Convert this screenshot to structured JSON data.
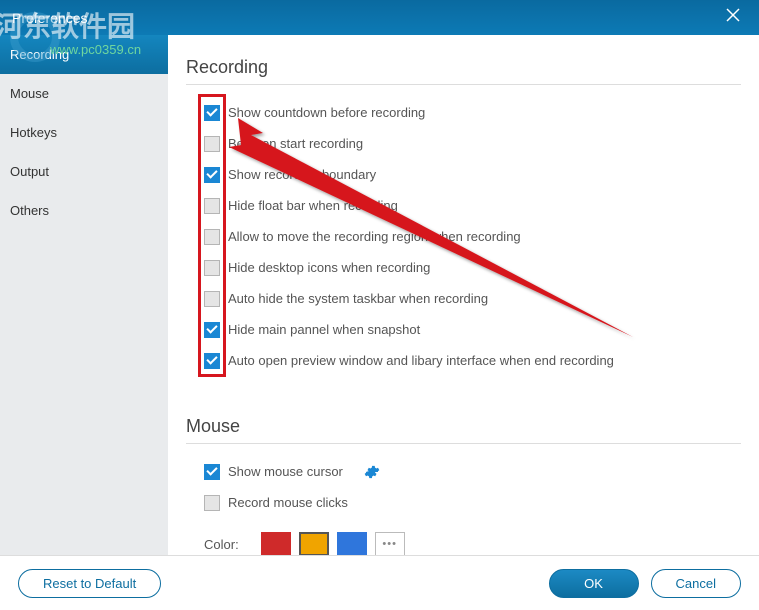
{
  "window": {
    "title": "Preferences"
  },
  "watermark": {
    "text": "河东软件园",
    "sub": "www.pc0359.cn"
  },
  "sidebar": {
    "items": [
      {
        "label": "Recording",
        "active": true
      },
      {
        "label": "Mouse",
        "active": false
      },
      {
        "label": "Hotkeys",
        "active": false
      },
      {
        "label": "Output",
        "active": false
      },
      {
        "label": "Others",
        "active": false
      }
    ]
  },
  "recording": {
    "title": "Recording",
    "options": [
      {
        "label": "Show countdown before recording",
        "checked": true
      },
      {
        "label": "Beep on start recording",
        "checked": false
      },
      {
        "label": "Show recording boundary",
        "checked": true
      },
      {
        "label": "Hide float bar when recording",
        "checked": false
      },
      {
        "label": "Allow to move the recording region when recording",
        "checked": false
      },
      {
        "label": "Hide desktop icons when recording",
        "checked": false
      },
      {
        "label": "Auto hide the system taskbar when recording",
        "checked": false
      },
      {
        "label": "Hide main pannel when snapshot",
        "checked": true
      },
      {
        "label": "Auto open preview window and libary interface when end recording",
        "checked": true
      }
    ]
  },
  "mouse": {
    "title": "Mouse",
    "show_cursor": {
      "label": "Show mouse cursor",
      "checked": true
    },
    "record_clicks": {
      "label": "Record mouse clicks",
      "checked": false
    },
    "color_label": "Color:",
    "colors": [
      "#cf2a2a",
      "#f0a400",
      "#2f76dc"
    ]
  },
  "footer": {
    "reset": "Reset to Default",
    "ok": "OK",
    "cancel": "Cancel"
  }
}
